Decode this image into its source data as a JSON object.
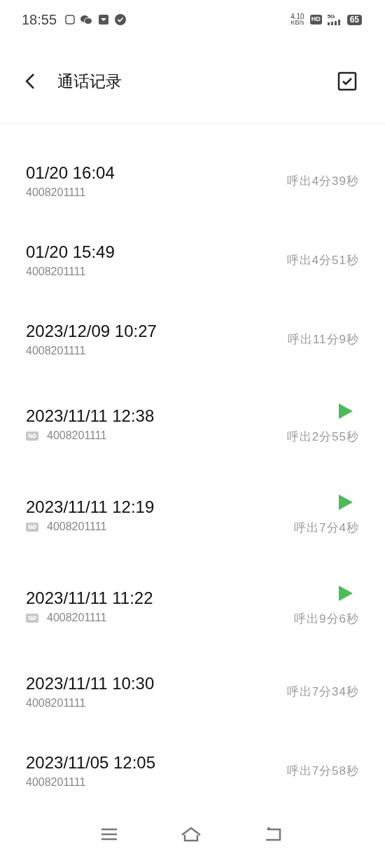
{
  "status_bar": {
    "time": "18:55",
    "net_speed": "4.10",
    "net_unit": "KB/s",
    "hd": "HD",
    "network": "5G",
    "battery": "65"
  },
  "header": {
    "title": "通话记录"
  },
  "calls": [
    {
      "time": "01/20 16:04",
      "number": "4008201111",
      "duration": "呼出4分39秒",
      "recorded": false
    },
    {
      "time": "01/20 15:49",
      "number": "4008201111",
      "duration": "呼出4分51秒",
      "recorded": false
    },
    {
      "time": "2023/12/09 10:27",
      "number": "4008201111",
      "duration": "呼出11分9秒",
      "recorded": false
    },
    {
      "time": "2023/11/11 12:38",
      "number": "4008201111",
      "duration": "呼出2分55秒",
      "recorded": true
    },
    {
      "time": "2023/11/11 12:19",
      "number": "4008201111",
      "duration": "呼出7分4秒",
      "recorded": true
    },
    {
      "time": "2023/11/11 11:22",
      "number": "4008201111",
      "duration": "呼出9分6秒",
      "recorded": true
    },
    {
      "time": "2023/11/11 10:30",
      "number": "4008201111",
      "duration": "呼出7分34秒",
      "recorded": false
    },
    {
      "time": "2023/11/05 12:05",
      "number": "4008201111",
      "duration": "呼出7分58秒",
      "recorded": false
    }
  ]
}
